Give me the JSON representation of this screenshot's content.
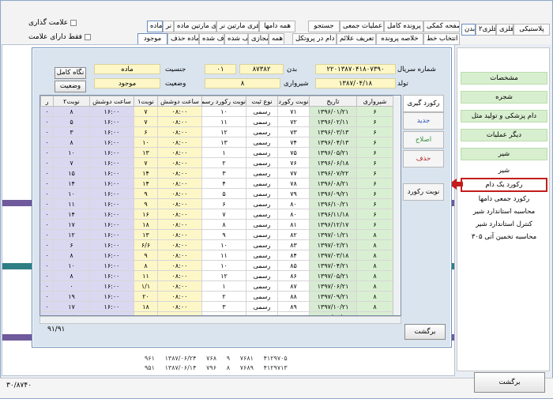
{
  "top": {
    "tabs": [
      "پلاستیکی",
      "فلزی",
      "فلزی۲",
      "بدن"
    ],
    "buttons_row1": [
      "صفحه کمکی",
      "پرونده کامل",
      "عملیات جمعی",
      "جستجو",
      "همه دامها",
      "فری مارتین نر",
      "فری مارتین ماده",
      "نر",
      "ماده"
    ],
    "buttons_row2": [
      "انتخاب خط",
      "خلاصه پرونده",
      "تعریف علائم",
      "دام در پروتکل",
      "همه",
      "مجازی",
      "تلف شده",
      "حذف شده",
      "آماده حذف",
      "موجود"
    ],
    "checkbox_mark": "علامت گذاری",
    "checkbox_only": "فقط دارای علامت"
  },
  "sidebar": {
    "items": [
      "مشخصات",
      "شجره",
      "دام پزشکی و تولید مثل",
      "دیگر عملیات",
      "شیر",
      "شیر",
      "رکورد یک دام",
      "رکورد جمعی دامها",
      "محاسبه استاندارد شیر",
      "کنترل استاندارد شیر",
      "محاسبه تخمین آتی ۳۰۵"
    ],
    "highlight": "رکورد یک دام"
  },
  "dialog": {
    "serial_label": "شماره سریال",
    "serial_value": "۲۲۰۱۳۸۷۰۴۱۸۰۷۳۹۰",
    "body_label": "بدن",
    "body_value": "۸۷۳۸۲",
    "code_value": "۰۱",
    "gender_label": "جنسیت",
    "gender_value": "ماده",
    "birth_label": "تولد",
    "birth_value": "۱۳۸۷/۰۴/۱۸",
    "lact_label": "شیرواری",
    "lact_value": "۸",
    "status_label": "وضعیت",
    "status_value": "موجود",
    "btn_keep": "نگاه کامل",
    "btn_status": "وضعیت",
    "side_header": "رکورد گیری",
    "btn_new": "جدید",
    "btn_edit": "اصلاح",
    "btn_delete": "حذف",
    "btn_type": "نوبت رکورد",
    "btn_back": "برگشت",
    "pager": "۹۱/۹۱"
  },
  "grid": {
    "headers": [
      "شیرواری",
      "تاریخ",
      "نوبت رکورد",
      "نوع ثبت",
      "نوبت رکورد رسمی",
      "ساعت دوشش",
      "نوبت۱",
      "ساعت دوشش",
      "نوبت۲",
      "ر"
    ],
    "rows": [
      [
        "۶",
        "۱۳۹۶/۰۱/۲۱",
        "۷۱",
        "رسمی",
        "۱۰",
        "۰۸:۰۰",
        "۷",
        "۱۶:۰۰",
        "۸",
        "۰"
      ],
      [
        "۶",
        "۱۳۹۶/۰۲/۱۱",
        "۷۲",
        "رسمی",
        "۱۱",
        "۰۸:۰۰",
        "۷",
        "۱۶:۰۰",
        "۵",
        "۰"
      ],
      [
        "۶",
        "۱۳۹۶/۰۳/۱۳",
        "۷۳",
        "رسمی",
        "۱۲",
        "۰۸:۰۰",
        "۶",
        "۱۶:۰۰",
        "۳",
        "۰"
      ],
      [
        "۶",
        "۱۳۹۶/۰۴/۱۳",
        "۷۴",
        "رسمی",
        "۱۳",
        "۰۸:۰۰",
        "۱۰",
        "۱۶:۰۰",
        "۸",
        "۰"
      ],
      [
        "۶",
        "۱۳۹۶/۰۵/۲۱",
        "۷۵",
        "رسمی",
        "۱",
        "۰۸:۰۰",
        "۱۳",
        "۱۶:۰۰",
        "۱۰",
        "۰"
      ],
      [
        "۶",
        "۱۳۹۶/۰۶/۱۸",
        "۷۶",
        "رسمی",
        "۲",
        "۰۸:۰۰",
        "۷",
        "۱۶:۰۰",
        "۷",
        "۰"
      ],
      [
        "۶",
        "۱۳۹۶/۰۷/۲۲",
        "۷۷",
        "رسمی",
        "۳",
        "۰۸:۰۰",
        "۱۴",
        "۱۶:۰۰",
        "۱۵",
        "۰"
      ],
      [
        "۶",
        "۱۳۹۶/۰۸/۲۱",
        "۷۸",
        "رسمی",
        "۴",
        "۰۸:۰۰",
        "۱۴",
        "۱۶:۰۰",
        "۱۴",
        "۰"
      ],
      [
        "۶",
        "۱۳۹۶/۰۹/۲۱",
        "۷۹",
        "رسمی",
        "۵",
        "۰۸:۰۰",
        "۹",
        "۱۶:۰۰",
        "۱۰",
        "۰"
      ],
      [
        "۶",
        "۱۳۹۶/۱۰/۲۱",
        "۸۰",
        "رسمی",
        "۶",
        "۰۸:۰۰",
        "۹",
        "۱۶:۰۰",
        "۱۱",
        "۰"
      ],
      [
        "۶",
        "۱۳۹۶/۱۱/۱۸",
        "۸۰",
        "رسمی",
        "۷",
        "۰۸:۰۰",
        "۱۶",
        "۱۶:۰۰",
        "۱۴",
        "۰"
      ],
      [
        "۶",
        "۱۳۹۶/۱۲/۱۷",
        "۸۱",
        "رسمی",
        "۸",
        "۰۸:۰۰",
        "۱۸",
        "۱۶:۰۰",
        "۱۷",
        "۰"
      ],
      [
        "۸",
        "۱۳۹۷/۰۱/۲۱",
        "۸۲",
        "رسمی",
        "۹",
        "۰۸:۰۰",
        "۱۳",
        "۱۶:۰۰",
        "۱۲",
        "۰"
      ],
      [
        "۸",
        "۱۳۹۷/۰۲/۲۱",
        "۸۳",
        "رسمی",
        "۱۰",
        "۰۸:۰۰",
        "۶/۶",
        "۱۶:۰۰",
        "۶",
        "۰"
      ],
      [
        "۸",
        "۱۳۹۷/۰۳/۱۸",
        "۸۴",
        "رسمی",
        "۱۱",
        "۰۸:۰۰",
        "۹",
        "۱۶:۰۰",
        "۸",
        "۰"
      ],
      [
        "۸",
        "۱۳۹۷/۰۴/۲۱",
        "۸۵",
        "رسمی",
        "۱۰",
        "۰۸:۰۰",
        "۸",
        "۱۶:۰۰",
        "۱۰",
        "۰"
      ],
      [
        "۸",
        "۱۳۹۷/۰۵/۲۱",
        "۸۶",
        "رسمی",
        "۱۲",
        "۰۸:۰۰",
        "۱۱",
        "۱۶:۰۰",
        "۸",
        "۰"
      ],
      [
        "۸",
        "۱۳۹۷/۰۶/۲۱",
        "۸۷",
        "رسمی",
        "۱",
        "۰۸:۰۰",
        "۱/۱",
        "۱۶:۰۰",
        "۰",
        "۰"
      ],
      [
        "۸",
        "۱۳۹۷/۰۹/۲۱",
        "۸۸",
        "رسمی",
        "۲",
        "۰۸:۰۰",
        "۲۰",
        "۱۶:۰۰",
        "۱۹",
        "۰"
      ],
      [
        "۸",
        "۱۳۹۷/۱۰/۲۱",
        "۸۹",
        "رسمی",
        "۳",
        "۰۸:۰۰",
        "۱۸",
        "۱۶:۰۰",
        "۱۷",
        "۰"
      ],
      [
        "۸",
        "۱۳۹۷/۱۱/۲۴",
        "۹۰",
        "رسمی",
        "۴",
        "۰۸:۰۰",
        "۱۸",
        "۱۶:۰۰",
        "۱۵",
        "۰"
      ],
      [
        "۸",
        "۱۳۹۷/۱۲/۲۱",
        "۹۱",
        "رسمی",
        "۵",
        "۰۸:۰۰",
        "۲۰",
        "۱۶:۰۰",
        "۱۷",
        "۰"
      ]
    ],
    "selected_index": 21
  },
  "bg": {
    "rows": [
      [
        "۹۶۱",
        "۱۳۸۷/۰۶/۲۴",
        "۷۶۸",
        "۹",
        "۷۶۸۱",
        "۴۱۲۹۷۰۵"
      ],
      [
        "۹۵۱",
        "۱۳۸۷/۰۶/۱۴",
        "۷۹۶",
        "۸",
        "۷۶۸۹",
        "۴۱۲۹۷۱۳"
      ]
    ],
    "counter": "۳۰/۸۷۴۰"
  },
  "footer": {
    "back": "برگشت"
  }
}
